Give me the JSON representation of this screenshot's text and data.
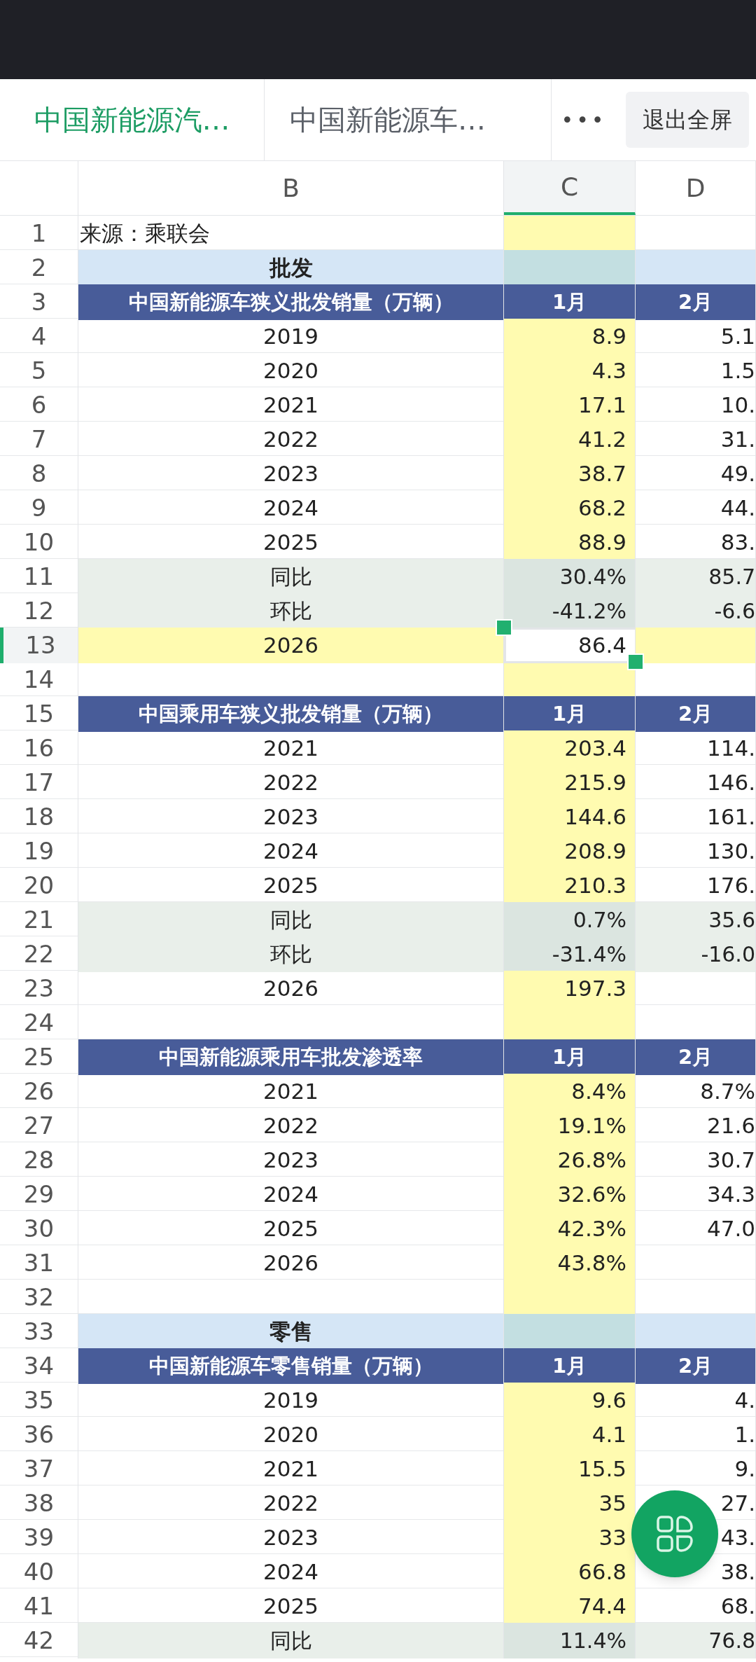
{
  "tabs": [
    {
      "label": "中国新能源汽…",
      "selected": true
    },
    {
      "label": "中国新能源车…",
      "selected": false
    }
  ],
  "more_button": "•••",
  "exit_button": "退出全屏",
  "columns": [
    {
      "label": "B",
      "selected": false
    },
    {
      "label": "C",
      "selected": true
    },
    {
      "label": "D",
      "selected": false
    }
  ],
  "rows": [
    {
      "num": "1",
      "kind": "note",
      "b": "来源：乘联会",
      "selected": false
    },
    {
      "num": "2",
      "kind": "section",
      "b": "批发",
      "selected": false
    },
    {
      "num": "3",
      "kind": "header",
      "b": "中国新能源车狭义批发销量（万辆）",
      "c": "1月",
      "d": "2月",
      "selected": false
    },
    {
      "num": "4",
      "kind": "data",
      "b": "2019",
      "c": "8.9",
      "d": "5.1",
      "selected": false
    },
    {
      "num": "5",
      "kind": "data",
      "b": "2020",
      "c": "4.3",
      "d": "1.5",
      "selected": false
    },
    {
      "num": "6",
      "kind": "data",
      "b": "2021",
      "c": "17.1",
      "d": "10.",
      "selected": false
    },
    {
      "num": "7",
      "kind": "data",
      "b": "2022",
      "c": "41.2",
      "d": "31.",
      "selected": false
    },
    {
      "num": "8",
      "kind": "data",
      "b": "2023",
      "c": "38.7",
      "d": "49.",
      "selected": false
    },
    {
      "num": "9",
      "kind": "data",
      "b": "2024",
      "c": "68.2",
      "d": "44.",
      "selected": false
    },
    {
      "num": "10",
      "kind": "data",
      "b": "2025",
      "c": "88.9",
      "d": "83.",
      "selected": false
    },
    {
      "num": "11",
      "kind": "ratio",
      "b": "同比",
      "c": "30.4%",
      "d": "85.7",
      "selected": false
    },
    {
      "num": "12",
      "kind": "ratio",
      "b": "环比",
      "c": "-41.2%",
      "d": "-6.6",
      "selected": false
    },
    {
      "num": "13",
      "kind": "current",
      "b": "2026",
      "c": "86.4",
      "selected": true
    },
    {
      "num": "14",
      "kind": "blank",
      "selected": false
    },
    {
      "num": "15",
      "kind": "header",
      "b": "中国乘用车狭义批发销量（万辆）",
      "c": "1月",
      "d": "2月",
      "selected": false
    },
    {
      "num": "16",
      "kind": "data",
      "b": "2021",
      "c": "203.4",
      "d": "114.",
      "selected": false
    },
    {
      "num": "17",
      "kind": "data",
      "b": "2022",
      "c": "215.9",
      "d": "146.",
      "selected": false
    },
    {
      "num": "18",
      "kind": "data",
      "b": "2023",
      "c": "144.6",
      "d": "161.",
      "selected": false
    },
    {
      "num": "19",
      "kind": "data",
      "b": "2024",
      "c": "208.9",
      "d": "130.",
      "selected": false
    },
    {
      "num": "20",
      "kind": "data",
      "b": "2025",
      "c": "210.3",
      "d": "176.",
      "selected": false
    },
    {
      "num": "21",
      "kind": "ratio",
      "b": "同比",
      "c": "0.7%",
      "d": "35.6",
      "selected": false
    },
    {
      "num": "22",
      "kind": "ratio",
      "b": "环比",
      "c": "-31.4%",
      "d": "-16.0",
      "selected": false
    },
    {
      "num": "23",
      "kind": "data",
      "b": "2026",
      "c": "197.3",
      "selected": false
    },
    {
      "num": "24",
      "kind": "blank",
      "selected": false
    },
    {
      "num": "25",
      "kind": "header",
      "b": "中国新能源乘用车批发渗透率",
      "c": "1月",
      "d": "2月",
      "selected": false
    },
    {
      "num": "26",
      "kind": "data",
      "b": "2021",
      "c": "8.4%",
      "d": "8.7%",
      "selected": false
    },
    {
      "num": "27",
      "kind": "data",
      "b": "2022",
      "c": "19.1%",
      "d": "21.6",
      "selected": false
    },
    {
      "num": "28",
      "kind": "data",
      "b": "2023",
      "c": "26.8%",
      "d": "30.7",
      "selected": false
    },
    {
      "num": "29",
      "kind": "data",
      "b": "2024",
      "c": "32.6%",
      "d": "34.3",
      "selected": false
    },
    {
      "num": "30",
      "kind": "data",
      "b": "2025",
      "c": "42.3%",
      "d": "47.0",
      "selected": false
    },
    {
      "num": "31",
      "kind": "data",
      "b": "2026",
      "c": "43.8%",
      "selected": false
    },
    {
      "num": "32",
      "kind": "blank",
      "selected": false
    },
    {
      "num": "33",
      "kind": "section",
      "b": "零售",
      "selected": false
    },
    {
      "num": "34",
      "kind": "header",
      "b": "中国新能源车零售销量（万辆）",
      "c": "1月",
      "d": "2月",
      "selected": false
    },
    {
      "num": "35",
      "kind": "data",
      "b": "2019",
      "c": "9.6",
      "d": "4.",
      "selected": false
    },
    {
      "num": "36",
      "kind": "data",
      "b": "2020",
      "c": "4.1",
      "d": "1.",
      "selected": false
    },
    {
      "num": "37",
      "kind": "data",
      "b": "2021",
      "c": "15.5",
      "d": "9.",
      "selected": false
    },
    {
      "num": "38",
      "kind": "data",
      "b": "2022",
      "c": "35",
      "d": "27.",
      "selected": false
    },
    {
      "num": "39",
      "kind": "data",
      "b": "2023",
      "c": "33",
      "d": "43.",
      "selected": false
    },
    {
      "num": "40",
      "kind": "data",
      "b": "2024",
      "c": "66.8",
      "d": "38.",
      "selected": false
    },
    {
      "num": "41",
      "kind": "data",
      "b": "2025",
      "c": "74.4",
      "d": "68.",
      "selected": false
    },
    {
      "num": "42",
      "kind": "ratio",
      "b": "同比",
      "c": "11.4%",
      "d": "76.8",
      "selected": false
    }
  ]
}
